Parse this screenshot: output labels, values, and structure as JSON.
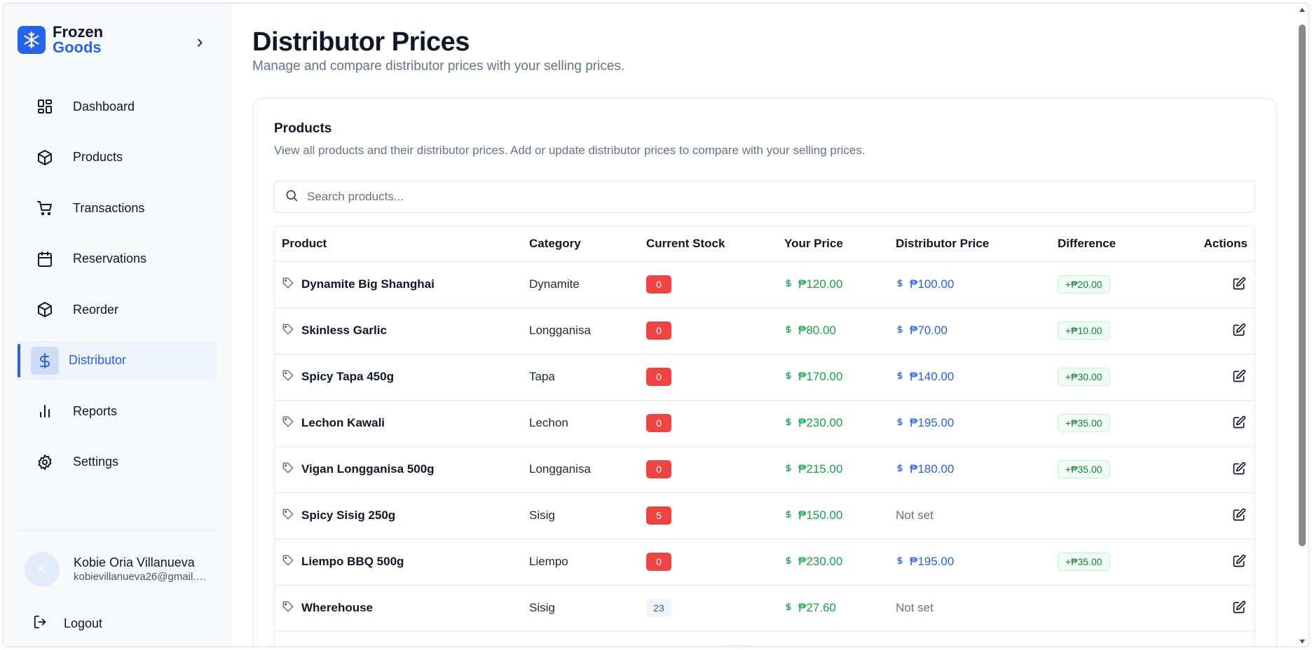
{
  "brand": {
    "line1": "Frozen",
    "line2": "Goods"
  },
  "sidebar": {
    "items": [
      {
        "label": "Dashboard",
        "icon": "dashboard-grid-icon"
      },
      {
        "label": "Products",
        "icon": "box-icon"
      },
      {
        "label": "Transactions",
        "icon": "cart-icon"
      },
      {
        "label": "Reservations",
        "icon": "calendar-icon"
      },
      {
        "label": "Reorder",
        "icon": "box-icon"
      },
      {
        "label": "Distributor",
        "icon": "dollar-icon",
        "active": true
      },
      {
        "label": "Reports",
        "icon": "bar-chart-icon"
      },
      {
        "label": "Settings",
        "icon": "gear-icon"
      }
    ]
  },
  "user": {
    "initial": "K",
    "name": "Kobie Oria Villanueva",
    "email": "kobievillanueva26@gmail.c..."
  },
  "logout_label": "Logout",
  "page": {
    "title": "Distributor Prices",
    "subtitle": "Manage and compare distributor prices with your selling prices."
  },
  "card": {
    "title": "Products",
    "description": "View all products and their distributor prices. Add or update distributor prices to compare with your selling prices."
  },
  "search": {
    "placeholder": "Search products..."
  },
  "table": {
    "headers": [
      "Product",
      "Category",
      "Current Stock",
      "Your Price",
      "Distributor Price",
      "Difference",
      "Actions"
    ],
    "rows": [
      {
        "product": "Dynamite Big Shanghai",
        "category": "Dynamite",
        "stock": "0",
        "stock_level": "low",
        "your_price": "₱120.00",
        "distributor_price": "₱100.00",
        "difference": "+₱20.00"
      },
      {
        "product": "Skinless Garlic",
        "category": "Longganisa",
        "stock": "0",
        "stock_level": "low",
        "your_price": "₱80.00",
        "distributor_price": "₱70.00",
        "difference": "+₱10.00"
      },
      {
        "product": "Spicy Tapa 450g",
        "category": "Tapa",
        "stock": "0",
        "stock_level": "low",
        "your_price": "₱170.00",
        "distributor_price": "₱140.00",
        "difference": "+₱30.00"
      },
      {
        "product": "Lechon Kawali",
        "category": "Lechon",
        "stock": "0",
        "stock_level": "low",
        "your_price": "₱230.00",
        "distributor_price": "₱195.00",
        "difference": "+₱35.00"
      },
      {
        "product": "Vigan Longganisa 500g",
        "category": "Longganisa",
        "stock": "0",
        "stock_level": "low",
        "your_price": "₱215.00",
        "distributor_price": "₱180.00",
        "difference": "+₱35.00"
      },
      {
        "product": "Spicy Sisig 250g",
        "category": "Sisig",
        "stock": "5",
        "stock_level": "low",
        "your_price": "₱150.00",
        "distributor_price": null,
        "distributor_not_set": "Not set",
        "difference": null
      },
      {
        "product": "Liempo BBQ 500g",
        "category": "Liempo",
        "stock": "0",
        "stock_level": "low",
        "your_price": "₱230.00",
        "distributor_price": "₱195.00",
        "difference": "+₱35.00"
      },
      {
        "product": "Wherehouse",
        "category": "Sisig",
        "stock": "23",
        "stock_level": "ok",
        "your_price": "₱27.60",
        "distributor_price": null,
        "distributor_not_set": "Not set",
        "difference": null
      }
    ]
  },
  "colors": {
    "accent": "#2563eb",
    "green": "#16a34a",
    "danger": "#ef4444"
  }
}
